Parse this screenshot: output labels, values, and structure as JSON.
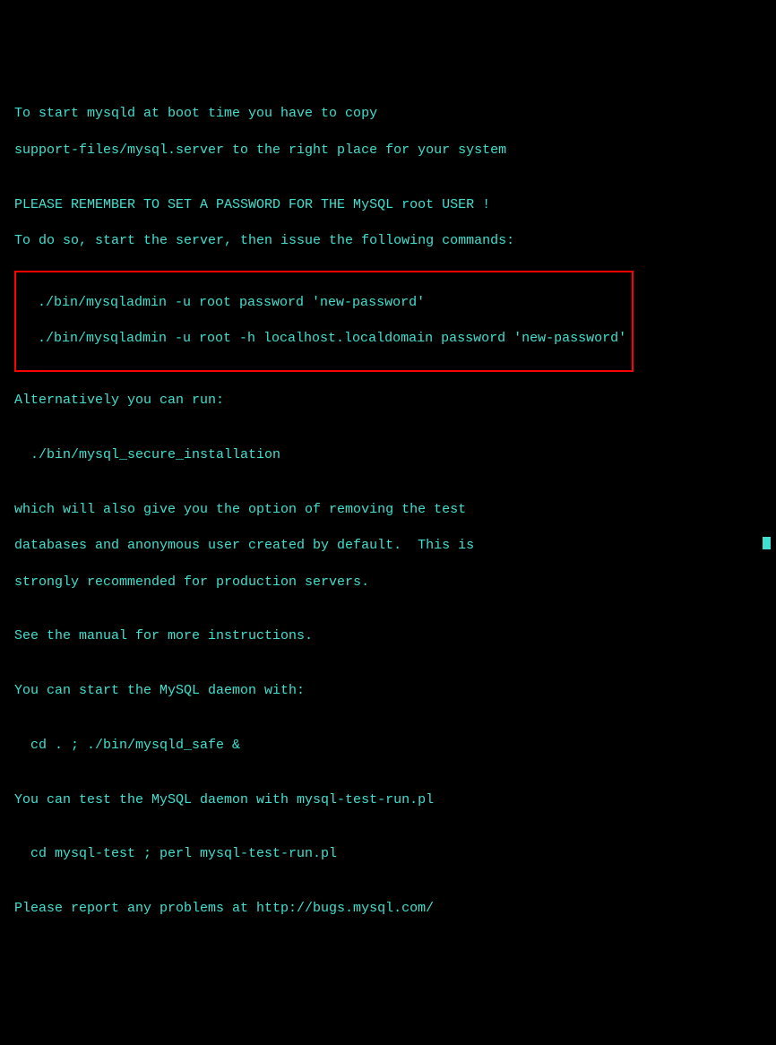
{
  "terminal": {
    "line1": "To start mysqld at boot time you have to copy",
    "line2": "support-files/mysql.server to the right place for your system",
    "line3": "",
    "line4": "PLEASE REMEMBER TO SET A PASSWORD FOR THE MySQL root USER !",
    "line5": "To do so, start the server, then issue the following commands:",
    "highlighted": {
      "cmd1": "  ./bin/mysqladmin -u root password 'new-password'",
      "cmd2": "  ./bin/mysqladmin -u root -h localhost.localdomain password 'new-password'"
    },
    "line6": "",
    "line7": "Alternatively you can run:",
    "line8": "",
    "line9": "  ./bin/mysql_secure_installation",
    "line10": "",
    "line11": "which will also give you the option of removing the test",
    "line12": "databases and anonymous user created by default.  This is",
    "line13": "strongly recommended for production servers.",
    "line14": "",
    "line15": "See the manual for more instructions.",
    "line16": "",
    "line17": "You can start the MySQL daemon with:",
    "line18": "",
    "line19": "  cd . ; ./bin/mysqld_safe &",
    "line20": "",
    "line21": "You can test the MySQL daemon with mysql-test-run.pl",
    "line22": "",
    "line23": "  cd mysql-test ; perl mysql-test-run.pl",
    "line24": "",
    "line25": "Please report any problems at http://bugs.mysql.com/"
  }
}
